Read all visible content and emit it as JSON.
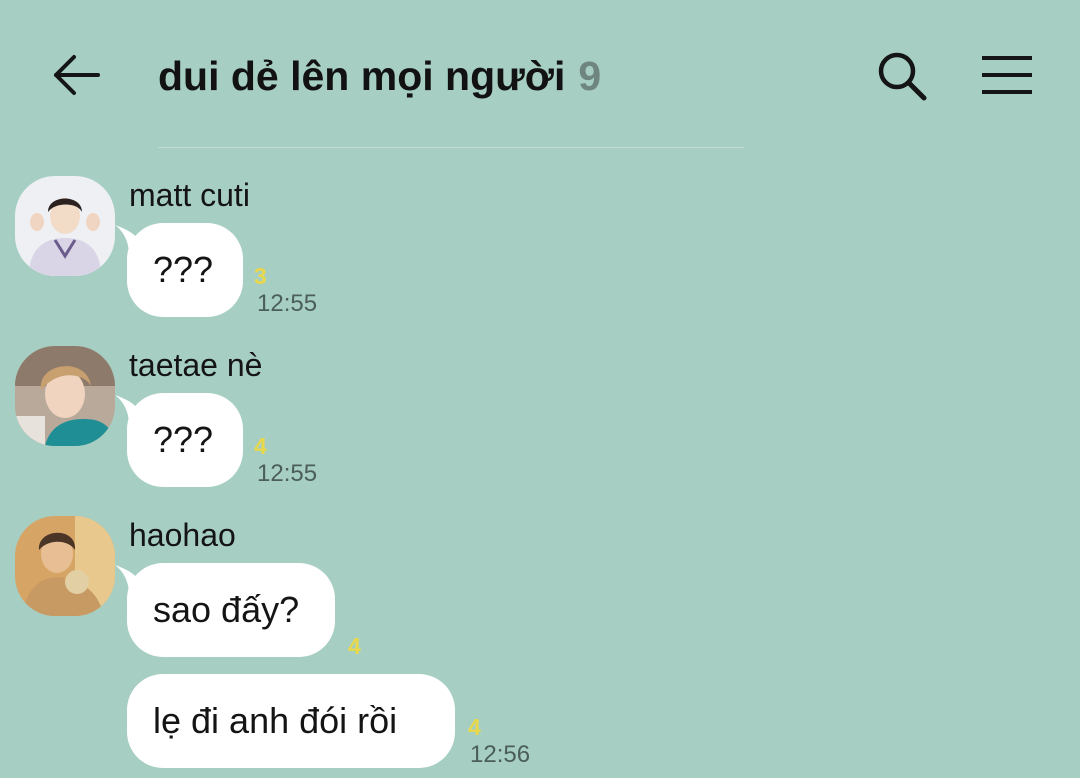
{
  "header": {
    "title": "dui dẻ lên mọi người",
    "member_count": "9",
    "back_icon": "back-arrow-icon",
    "search_icon": "search-icon",
    "menu_icon": "menu-icon"
  },
  "colors": {
    "background": "#a6cec3",
    "bubble": "#ffffff",
    "unread": "#e8d84a",
    "time": "#4b5e59",
    "member_count": "#6f8680"
  },
  "messages": [
    {
      "sender": "matt cuti",
      "text": "???",
      "unread": "3",
      "time": "12:55"
    },
    {
      "sender": "taetae nè",
      "text": "???",
      "unread": "4",
      "time": "12:55"
    },
    {
      "sender": "haohao",
      "text": "sao đấy?",
      "unread": "4",
      "time": ""
    },
    {
      "sender": "",
      "text": "lẹ đi anh đói rồi",
      "unread": "4",
      "time": "12:56"
    }
  ]
}
